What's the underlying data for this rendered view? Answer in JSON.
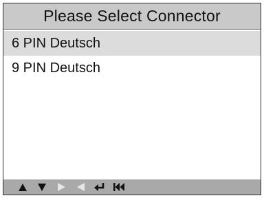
{
  "header": {
    "title": "Please Select Connector"
  },
  "connectors": [
    {
      "label": "6 PIN Deutsch",
      "selected": true
    },
    {
      "label": "9 PIN Deutsch",
      "selected": false
    }
  ],
  "toolbar": {
    "icons": [
      "up-arrow-icon",
      "down-arrow-icon",
      "right-arrow-icon",
      "left-arrow-icon",
      "enter-icon",
      "back-to-start-icon"
    ],
    "active_color": "#111111",
    "inactive_color": "#e6e6e6"
  },
  "colors": {
    "title_bar": "#c9c9c9",
    "selected_row": "#dcdcdc",
    "bottom_bar": "#a9a9a9"
  }
}
